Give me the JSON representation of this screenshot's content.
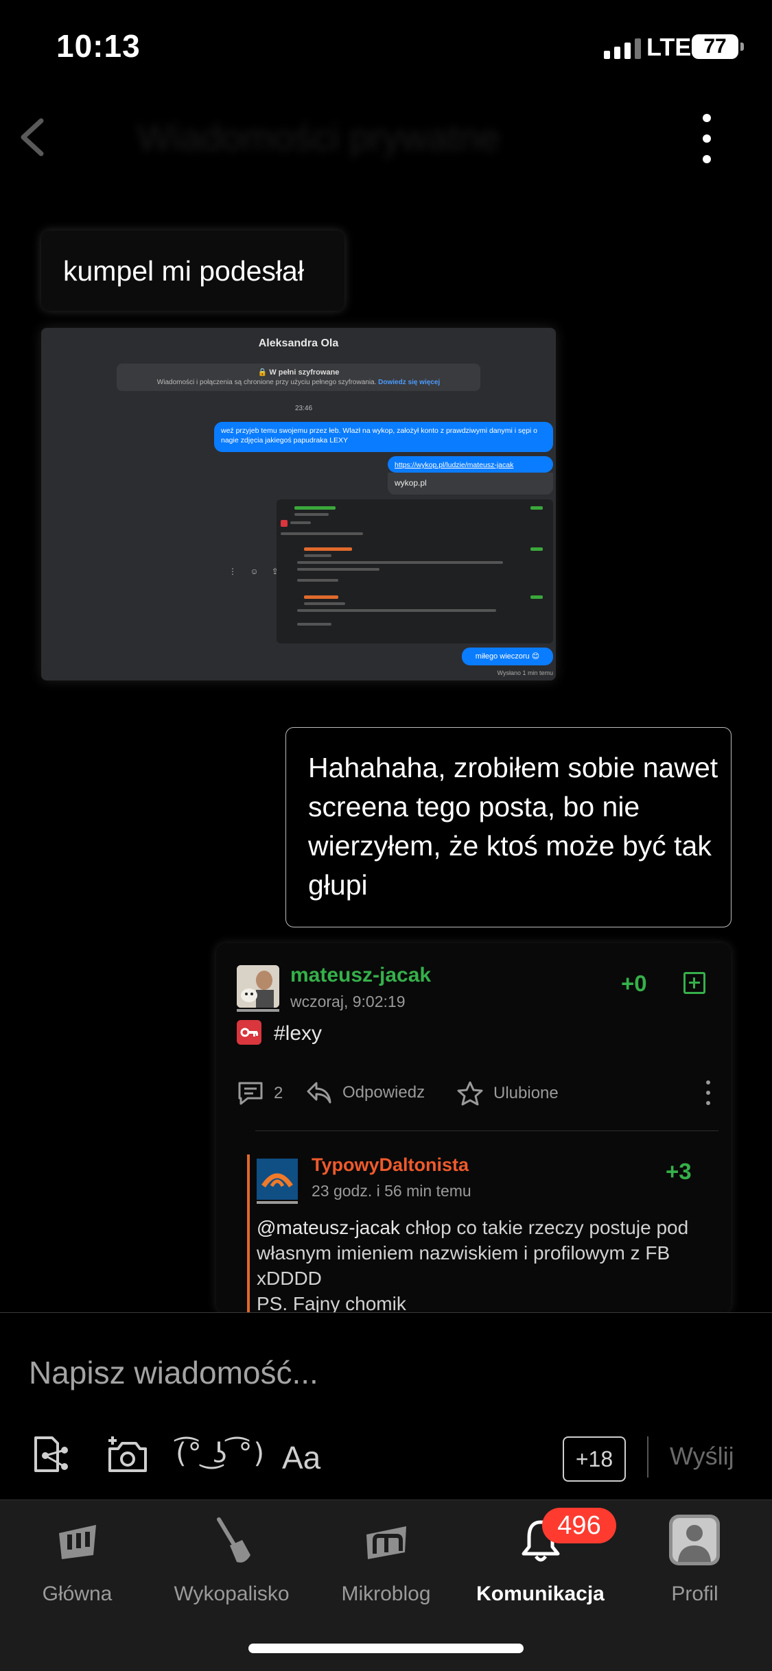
{
  "status": {
    "time": "10:13",
    "network": "LTE",
    "battery": "77"
  },
  "header": {
    "title": "Wiadomości prywatne"
  },
  "messages": {
    "incoming_text": "kumpel mi podesłał",
    "outgoing_text": "Hahahaha, zrobiłem sobie nawet screena tego posta, bo nie wierzyłem, że ktoś może być tak głupi"
  },
  "screenshot": {
    "name": "Aleksandra Ola",
    "encryption_title": "🔒 W pełni szyfrowane",
    "encryption_text": "Wiadomości i połączenia są chronione przy użyciu pełnego szyfrowania.",
    "encryption_link": "Dowiedz się więcej",
    "timestamp": "23:46",
    "msg1": "weź przyjeb temu swojemu przez łeb. Wlazł na wykop, założył konto z prawdziwymi danymi i sępi o nagie zdjęcia jakiegoś papudraka LEXY",
    "msg2": "https://wykop.pl/ludzie/mateusz-jacak",
    "link_preview": "wykop.pl",
    "msg3": "miłego wieczoru 😊",
    "sent": "Wysłano 1 min temu"
  },
  "post": {
    "author": "mateusz-jacak",
    "date": "wczoraj, 9:02:19",
    "votes": "+0",
    "tag": "#lexy",
    "comments": "2",
    "reply_label": "Odpowiedz",
    "fav_label": "Ulubione",
    "reply": {
      "author": "TypowyDaltonista",
      "date": "23 godz. i 56 min temu",
      "votes": "+3",
      "mention": "@mateusz-jacak",
      "text": " chłop co takie rzeczy postuje pod własnym imieniem nazwiskiem i profilowym z FB xDDDD",
      "text2": "PS. Fajny chomik"
    }
  },
  "composer": {
    "placeholder": "Napisz wiadomość...",
    "lenny": "(͡° ͜ʖ ͡°)",
    "font_label": "Aa",
    "count": "+18",
    "send": "Wyślij"
  },
  "tabs": [
    {
      "label": "Główna",
      "icon": "wykop-home-icon"
    },
    {
      "label": "Wykopalisko",
      "icon": "shovel-icon"
    },
    {
      "label": "Mikroblog",
      "icon": "mikroblog-icon"
    },
    {
      "label": "Komunikacja",
      "icon": "bell-icon",
      "active": true
    },
    {
      "label": "Profil",
      "icon": "profile-icon"
    }
  ],
  "notifications_badge": "496",
  "colors": {
    "accent_green": "#35b04a",
    "accent_orange": "#ef5a2c",
    "badge_red": "#ff3b30",
    "messenger_blue": "#0a7cff"
  }
}
